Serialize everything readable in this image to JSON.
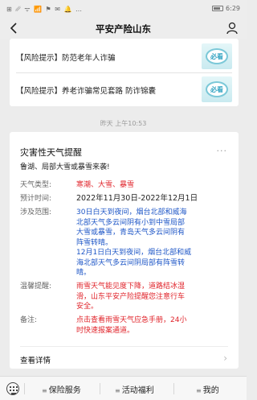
{
  "status_bar": {
    "left": "⊞ ␥ ᯤ 📶 ⚑ ✉ 🔔 …",
    "right_time": "6:29"
  },
  "header": {
    "title": "平安产险山东"
  },
  "news": [
    {
      "text": "【风险提示】防范老年人诈骗",
      "thumb_label": "必看"
    },
    {
      "text": "【风险提示】养老诈骗常见套路 防诈锦囊",
      "thumb_label": "必看"
    }
  ],
  "timestamp": "昨天 上午10:53",
  "alert": {
    "title": "灾害性天气提醒",
    "subtitle": "鲁湖、局部大雪或暴雪来袭!",
    "rows": [
      {
        "label": "天气类型:",
        "value": "寒潮、大雪、暴雪"
      },
      {
        "label": "预计时间:",
        "value": "2022年11月30日-2022年12月1日"
      },
      {
        "label": "涉及范围:",
        "value_lines": [
          "30日白天到夜间，烟台北部和威海",
          "北部天气多云间阴有小到中雪局部",
          "大雪或暴雪，青岛天气多云间阴有",
          "阵雪转晴。",
          "12月1日白天到夜间，烟台北部和威",
          "海北部天气多云间阴局部有阵雪转",
          "晴。"
        ]
      },
      {
        "label": "温馨提醒:",
        "value_lines": [
          "雨雪天气能见度下降，道路结冰湿",
          "滑，山东平安产险提醒您注意行车",
          "安全。"
        ]
      },
      {
        "label": "备注:",
        "value_lines": [
          "点击查看雨雪天气应急手册，24小",
          "时快速报案通道。"
        ]
      }
    ],
    "details_label": "查看详情",
    "more_label": "···"
  },
  "bottom_nav": {
    "items": [
      "保险服务",
      "活动福利",
      "我的"
    ],
    "menu_marker": "≡"
  },
  "colors": {
    "accent_red": "#e0232a",
    "link_blue": "#1f57c7"
  }
}
